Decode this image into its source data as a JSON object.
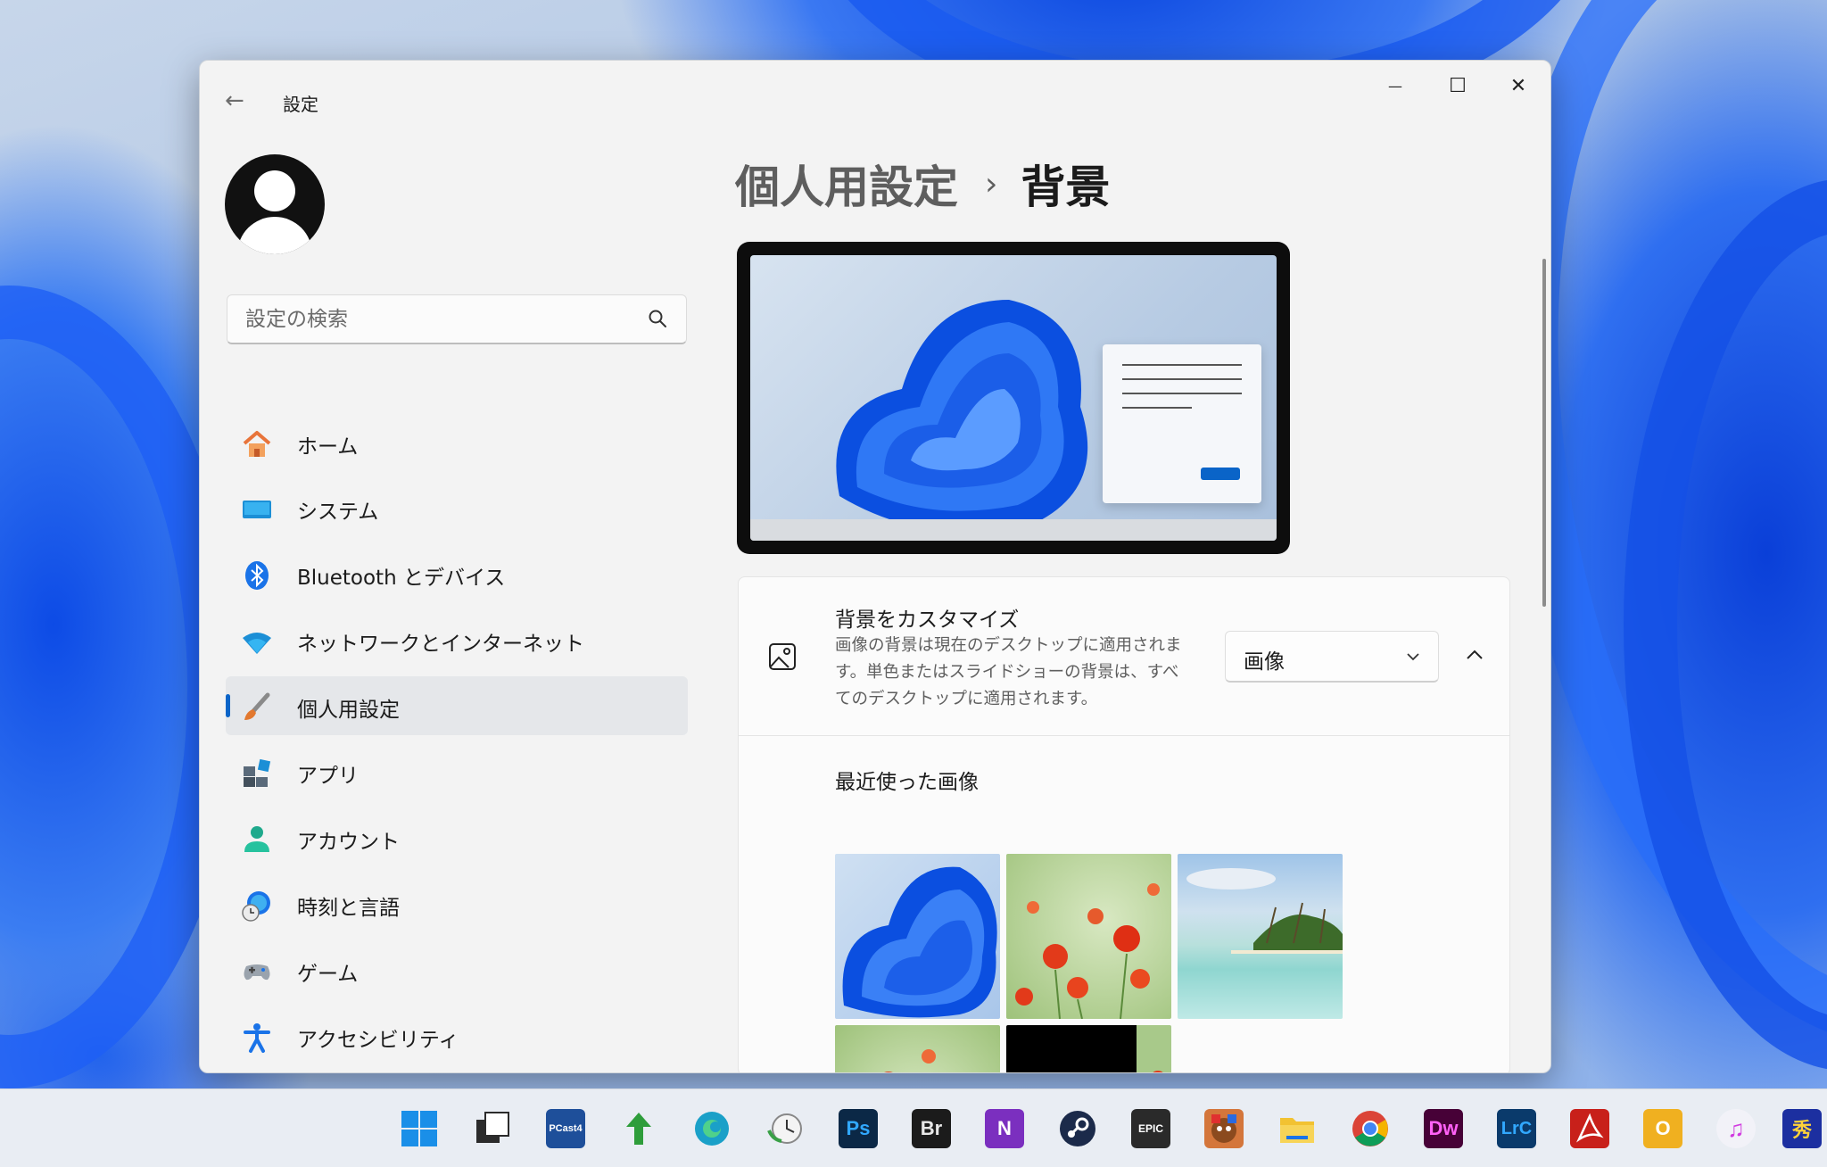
{
  "window": {
    "title": "設定",
    "back_icon": "back-arrow-icon",
    "minimize_glyph": "—",
    "maximize_glyph": "☐",
    "close_glyph": "✕"
  },
  "search": {
    "placeholder": "設定の検索",
    "value": "",
    "icon": "search-icon"
  },
  "sidebar": {
    "selected_index": 4,
    "items": [
      {
        "label": "ホーム",
        "icon": "home-icon"
      },
      {
        "label": "システム",
        "icon": "system-icon"
      },
      {
        "label": "Bluetooth とデバイス",
        "icon": "bluetooth-icon"
      },
      {
        "label": "ネットワークとインターネット",
        "icon": "wifi-icon"
      },
      {
        "label": "個人用設定",
        "icon": "brush-icon"
      },
      {
        "label": "アプリ",
        "icon": "apps-icon"
      },
      {
        "label": "アカウント",
        "icon": "account-icon"
      },
      {
        "label": "時刻と言語",
        "icon": "time-language-icon"
      },
      {
        "label": "ゲーム",
        "icon": "gamepad-icon"
      },
      {
        "label": "アクセシビリティ",
        "icon": "accessibility-icon"
      }
    ]
  },
  "breadcrumb": {
    "parent": "個人用設定",
    "separator": "›",
    "current": "背景"
  },
  "background_setting": {
    "title": "背景をカスタマイズ",
    "description": "画像の背景は現在のデスクトップに適用されます。単色またはスライドショーの背景は、すべてのデスクトップに適用されます。",
    "select_value": "画像",
    "icon": "picture-icon",
    "expanded": true
  },
  "recent_images": {
    "title": "最近使った画像",
    "images": [
      {
        "name": "windows-bloom",
        "kind": "bloom"
      },
      {
        "name": "poppy-field",
        "kind": "poppies"
      },
      {
        "name": "tropical-beach",
        "kind": "beach"
      },
      {
        "name": "poppy-field-2",
        "kind": "poppies"
      },
      {
        "name": "black-solid",
        "kind": "black"
      }
    ]
  },
  "taskbar": {
    "apps": [
      {
        "name": "start-button",
        "label": "",
        "color": "#1a73e8"
      },
      {
        "name": "task-view",
        "label": "",
        "color": "#2b2b2b"
      },
      {
        "name": "pcast-app",
        "label": "PCast4",
        "color": "#1e4f9a"
      },
      {
        "name": "arrow-app",
        "label": "",
        "color": "#2e9d3a"
      },
      {
        "name": "edge-browser",
        "label": "",
        "color": "#1aa0c8"
      },
      {
        "name": "clock-app",
        "label": "",
        "color": "#39a046"
      },
      {
        "name": "photoshop",
        "label": "Ps",
        "color": "#0b2846"
      },
      {
        "name": "bridge",
        "label": "Br",
        "color": "#1b1b1b"
      },
      {
        "name": "onenote",
        "label": "N",
        "color": "#7b2fbf"
      },
      {
        "name": "steam",
        "label": "",
        "color": "#1b2a4a"
      },
      {
        "name": "epic-games",
        "label": "EPIC",
        "color": "#2a2a2a"
      },
      {
        "name": "game-app",
        "label": "",
        "color": "#d4763b"
      },
      {
        "name": "file-explorer",
        "label": "",
        "color": "#f2c232"
      },
      {
        "name": "chrome",
        "label": "",
        "color": "#2d8a3d"
      },
      {
        "name": "dreamweaver",
        "label": "Dw",
        "color": "#470137"
      },
      {
        "name": "lightroom-classic",
        "label": "LrC",
        "color": "#0a3a6b"
      },
      {
        "name": "acrobat",
        "label": "",
        "color": "#c8201a"
      },
      {
        "name": "outlook-app",
        "label": "O",
        "color": "#f0b020"
      },
      {
        "name": "itunes",
        "label": "♫",
        "color": "#e9e9f2"
      },
      {
        "name": "game-app-2",
        "label": "秀",
        "color": "#1c2fa0"
      }
    ]
  }
}
